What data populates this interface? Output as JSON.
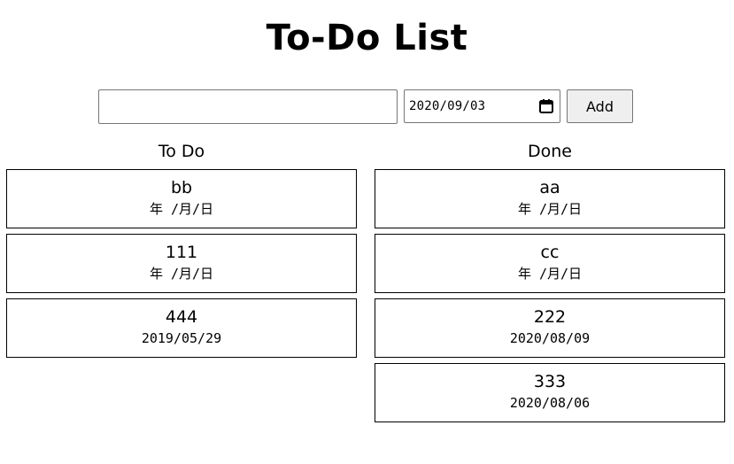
{
  "title": "To-Do List",
  "form": {
    "task_value": "",
    "date_value": "2020/09/03",
    "add_label": "Add"
  },
  "todo": {
    "heading": "To Do",
    "items": [
      {
        "title": "bb",
        "date": "年 /月/日"
      },
      {
        "title": "111",
        "date": "年 /月/日"
      },
      {
        "title": "444",
        "date": "2019/05/29"
      }
    ]
  },
  "done": {
    "heading": "Done",
    "items": [
      {
        "title": "aa",
        "date": "年 /月/日"
      },
      {
        "title": "cc",
        "date": "年 /月/日"
      },
      {
        "title": "222",
        "date": "2020/08/09"
      },
      {
        "title": "333",
        "date": "2020/08/06"
      }
    ]
  },
  "icons": {
    "date_picker": "calendar-icon"
  }
}
